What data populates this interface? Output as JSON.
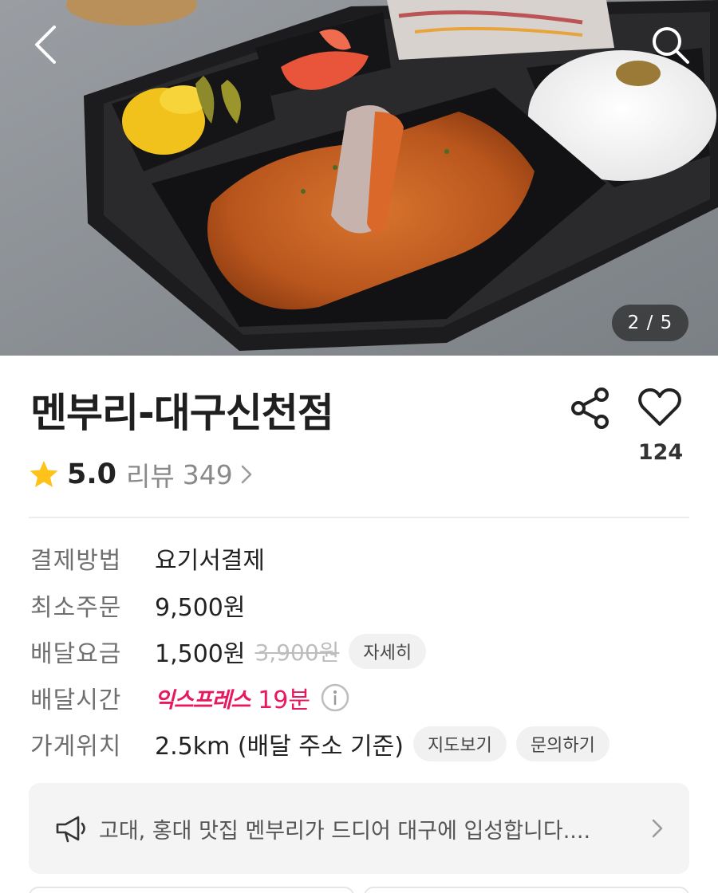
{
  "header": {
    "back_icon": "chevron-left-icon",
    "search_icon": "search-icon",
    "image_counter": "2 / 5"
  },
  "store": {
    "name": "멘부리-대구신천점",
    "like_count": "124",
    "rating": "5.0",
    "review_label": "리뷰",
    "review_count": "349"
  },
  "info": {
    "payment_label": "결제방법",
    "payment_value": "요기서결제",
    "min_order_label": "최소주문",
    "min_order_value": "9,500원",
    "delivery_fee_label": "배달요금",
    "delivery_fee_value": "1,500원",
    "delivery_fee_original": "3,900원",
    "delivery_fee_detail": "자세히",
    "delivery_time_label": "배달시간",
    "delivery_time_badge": "익스프레스",
    "delivery_time_value": "19분",
    "location_label": "가게위치",
    "location_value": "2.5km (배달 주소 기준)",
    "map_button": "지도보기",
    "inquiry_button": "문의하기"
  },
  "notice": {
    "text": "고대, 홍대 맛집 멘부리가 드디어 대구에 입성합니다...."
  },
  "colors": {
    "accent_pink": "#e8185f",
    "star_yellow": "#ffc21a"
  }
}
